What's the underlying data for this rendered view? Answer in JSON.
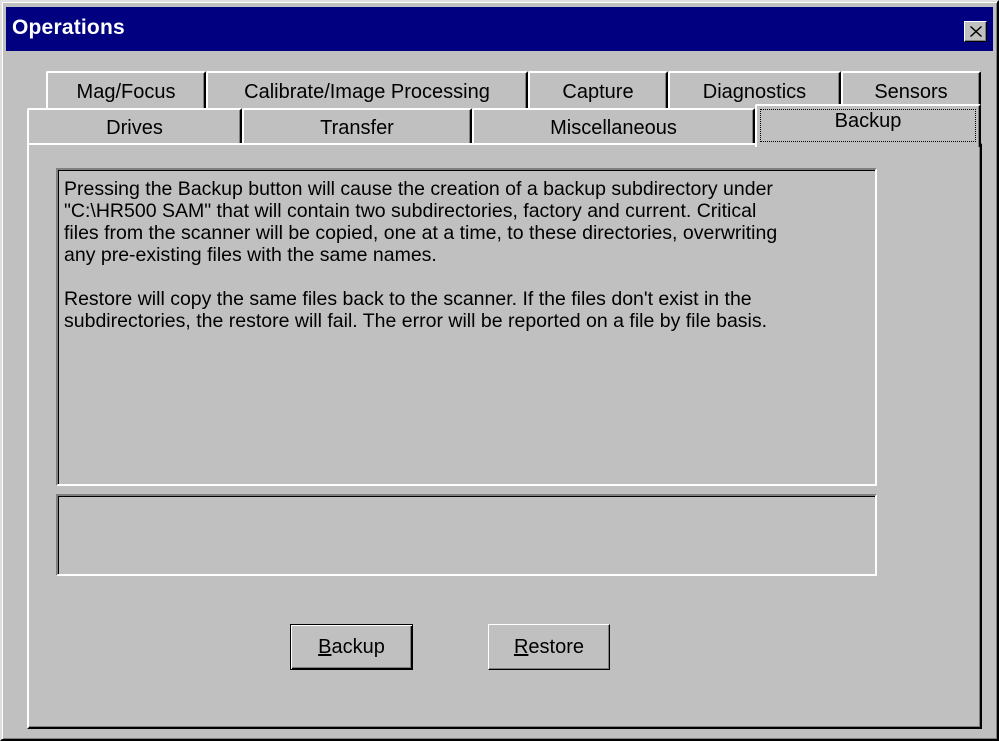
{
  "window": {
    "title": "Operations",
    "close_glyph": "✕"
  },
  "tabs": {
    "back_row": [
      "Mag/Focus",
      "Calibrate/Image Processing",
      "Capture",
      "Diagnostics",
      "Sensors"
    ],
    "front_row": [
      "Drives",
      "Transfer",
      "Miscellaneous",
      "Backup"
    ],
    "active": "Backup"
  },
  "backup_tab": {
    "description_paragraph_1": "Pressing the Backup button will cause the creation of a backup subdirectory under\n\"C:\\HR500 SAM\"  that will contain two subdirectories, factory and current.  Critical\nfiles from the scanner will be copied, one at a time, to these directories, overwriting\nany pre-existing files with the same names.",
    "description_paragraph_2": "Restore will copy the same files back to the scanner.  If the files don't exist in the\nsubdirectories, the restore will fail.  The error will be reported on a file by file basis.",
    "status_text": "",
    "backup_button": {
      "mnemonic": "B",
      "rest": "ackup"
    },
    "restore_button": {
      "mnemonic": "R",
      "rest": "estore"
    }
  },
  "icons": {
    "close": "close-icon"
  }
}
